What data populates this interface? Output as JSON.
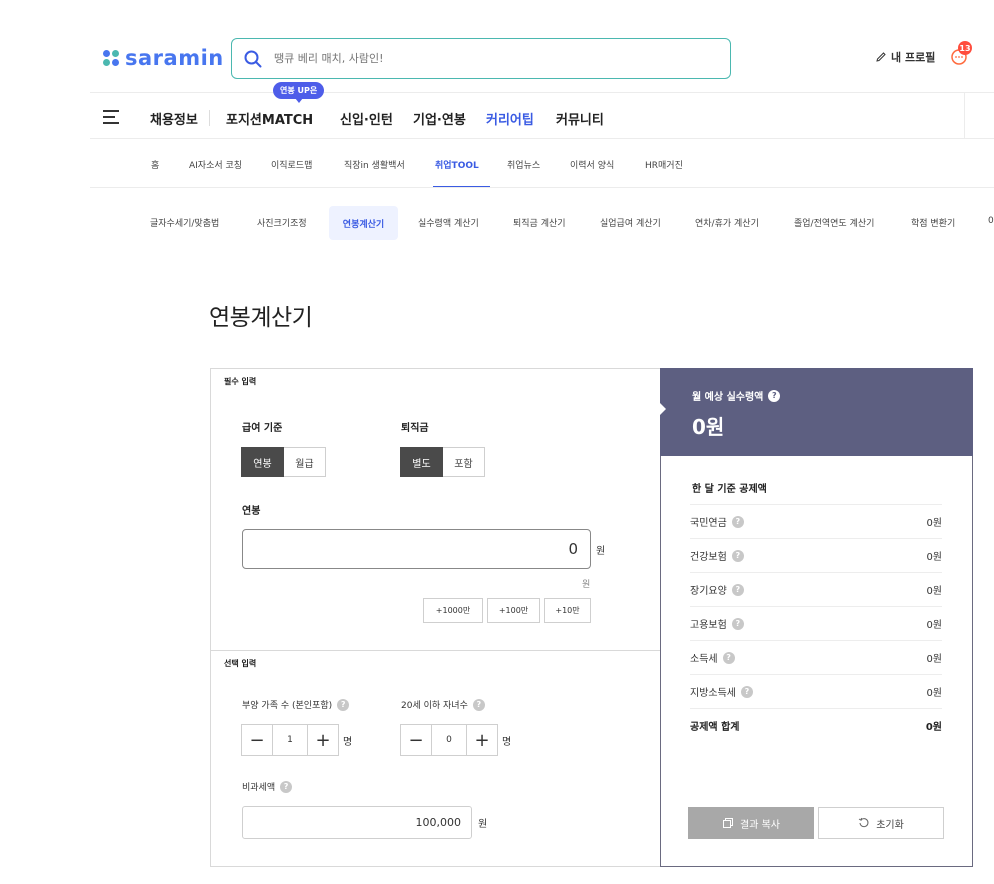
{
  "header": {
    "logo": "saramin",
    "logo_dot_colors": [
      "#4876ef",
      "#4bb8b0",
      "#4bb8b0",
      "#4876ef"
    ],
    "search_placeholder": "땡큐 베리 매치, 사람인!",
    "profile_label": "내 프로필",
    "notification_count": "13"
  },
  "main_nav": {
    "items": [
      "채용정보",
      "포지션MATCH",
      "신입·인턴",
      "기업·연봉",
      "커리어팁",
      "커뮤니티"
    ],
    "active_index": 4,
    "badge": "연봉 UP은"
  },
  "sub_nav": {
    "items": [
      "홈",
      "AI자소서 코칭",
      "이직로드맵",
      "직장in 생활백서",
      "취업TOOL",
      "취업뉴스",
      "이력서 양식",
      "HR매거진"
    ],
    "active_index": 4
  },
  "tool_tabs": {
    "items": [
      "글자수세기/맞춤법",
      "사진크기조정",
      "연봉계산기",
      "실수령액 계산기",
      "퇴직금 계산기",
      "실업급여 계산기",
      "연차/휴가 계산기",
      "졸업/전역연도 계산기",
      "학점 변환기",
      "0"
    ],
    "active_index": 2
  },
  "page_title": "연봉계산기",
  "form": {
    "required_label": "필수 입력",
    "pay_basis": {
      "label": "급여 기준",
      "options": [
        "연봉",
        "월급"
      ],
      "selected": 0
    },
    "severance": {
      "label": "퇴직금",
      "options": [
        "별도",
        "포함"
      ],
      "selected": 0
    },
    "salary": {
      "label": "연봉",
      "value": "0",
      "unit": "원",
      "hint_unit": "원"
    },
    "quick_add": [
      "+1000만",
      "+100만",
      "+10만"
    ],
    "optional_label": "선택 입력",
    "dependents": {
      "label": "부양 가족 수 (본인포함)",
      "value": "1",
      "unit": "명"
    },
    "children": {
      "label": "20세 이하 자녀수",
      "value": "0",
      "unit": "명"
    },
    "tax_free": {
      "label": "비과세액",
      "value": "100,000",
      "unit": "원"
    }
  },
  "result": {
    "monthly_label": "월 예상 실수령액",
    "monthly_value": "0원",
    "deduction_title": "한 달 기준 공제액",
    "deductions": [
      {
        "name": "국민연금",
        "value": "0원"
      },
      {
        "name": "건강보험",
        "value": "0원"
      },
      {
        "name": "장기요양",
        "value": "0원"
      },
      {
        "name": "고용보험",
        "value": "0원"
      },
      {
        "name": "소득세",
        "value": "0원"
      },
      {
        "name": "지방소득세",
        "value": "0원"
      }
    ],
    "total": {
      "name": "공제액 합계",
      "value": "0원"
    },
    "copy_button": "결과 복사",
    "reset_button": "초기화"
  }
}
